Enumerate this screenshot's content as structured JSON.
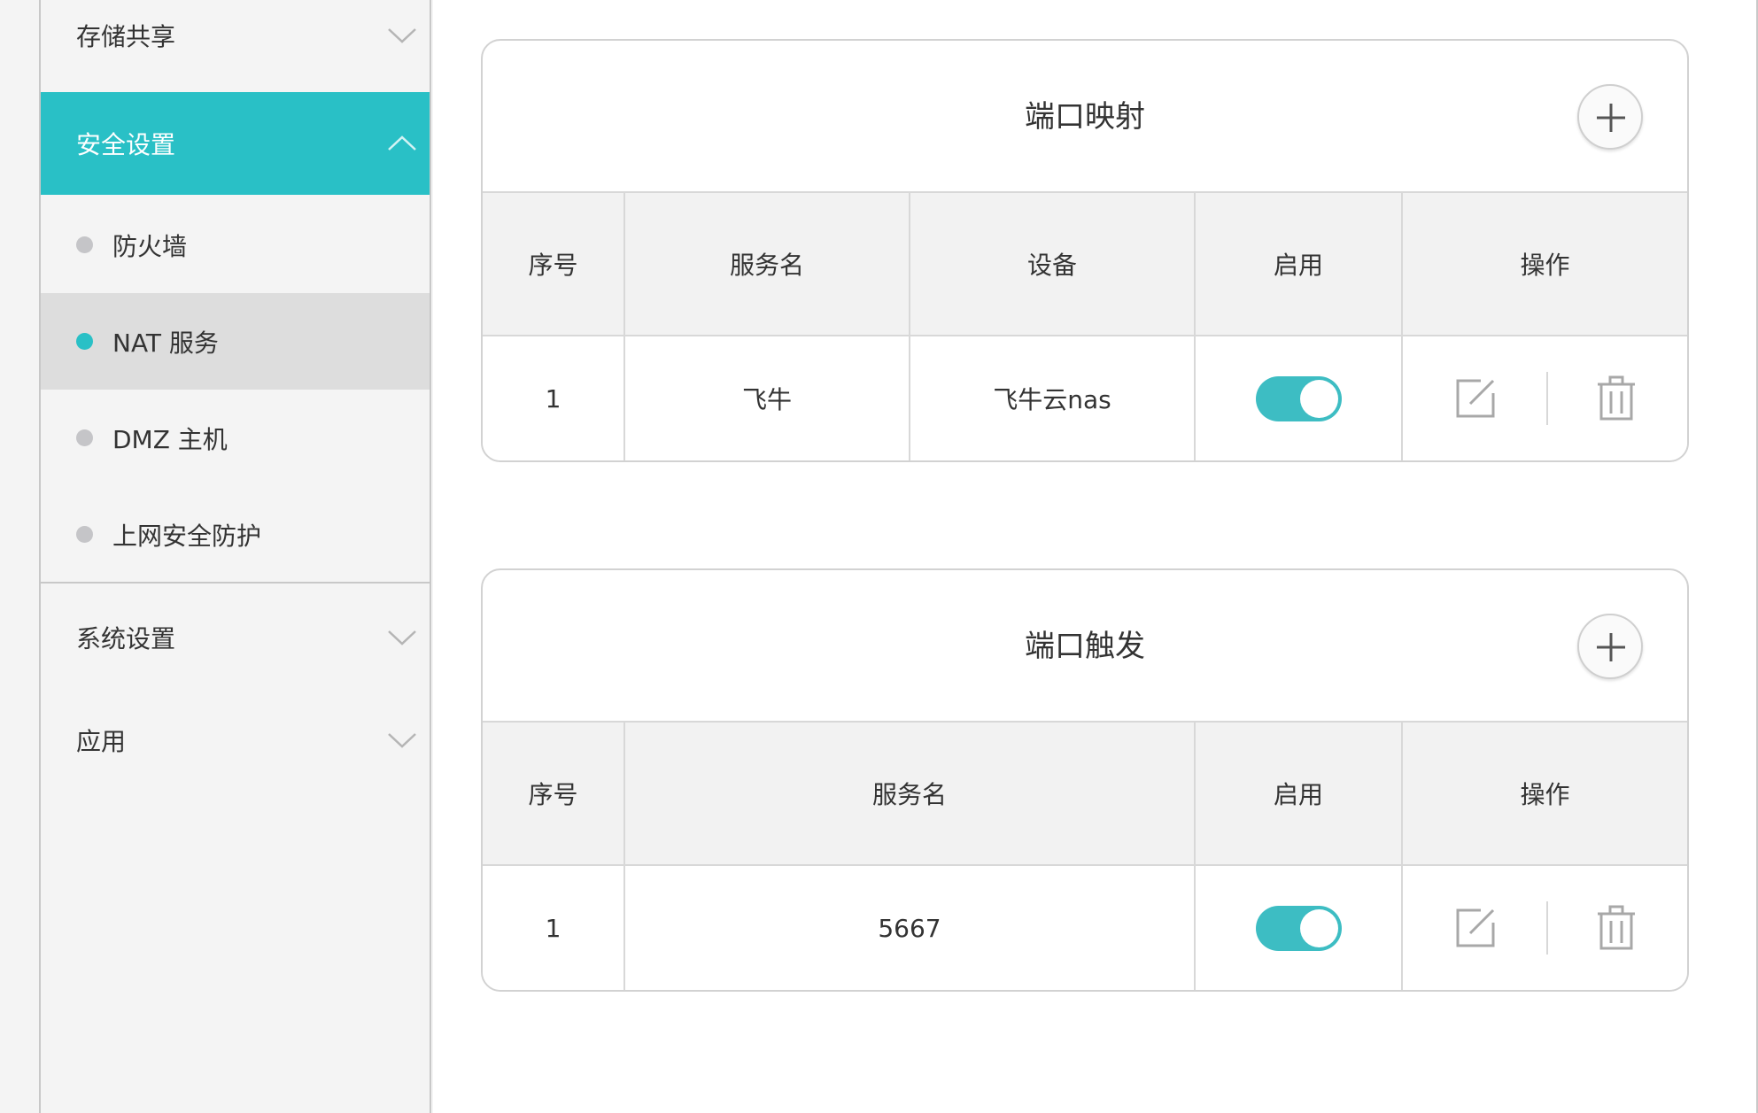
{
  "sidebar": {
    "storage": "存储共享",
    "security": "安全设置",
    "security_items": [
      "防火墙",
      "NAT 服务",
      "DMZ 主机",
      "上网安全防护"
    ],
    "system": "系统设置",
    "apps": "应用"
  },
  "port_mapping": {
    "title": "端口映射",
    "headers": [
      "序号",
      "服务名",
      "设备",
      "启用",
      "操作"
    ],
    "rows": [
      {
        "index": "1",
        "service": "飞牛",
        "device": "飞牛云nas",
        "enabled": true
      }
    ]
  },
  "port_trigger": {
    "title": "端口触发",
    "headers": [
      "序号",
      "服务名",
      "启用",
      "操作"
    ],
    "rows": [
      {
        "index": "1",
        "service": "5667",
        "enabled": true
      }
    ]
  },
  "colors": {
    "accent": "#29c0c6",
    "toggle_on": "#3dbdc3",
    "selected_bg": "#dddddd",
    "header_bg": "#f2f2f2"
  },
  "icons": {
    "collapsed": "chevron-down-icon",
    "expanded": "chevron-up-icon",
    "add": "plus-circle-icon",
    "edit": "edit-icon",
    "delete": "trash-icon"
  }
}
